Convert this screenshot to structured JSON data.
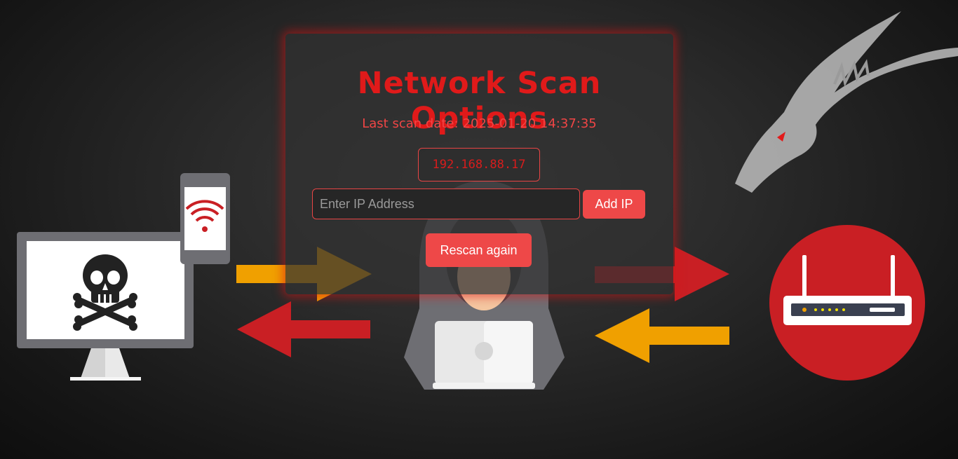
{
  "panel": {
    "title": "Network Scan Options",
    "last_scan_label": "Last scan date:",
    "last_scan_value": "2025-01-20 14:37:35",
    "current_ip": "192.168.88.17",
    "ip_input": {
      "value": "",
      "placeholder": "Enter IP Address"
    },
    "add_ip_label": "Add IP",
    "rescan_label": "Rescan again"
  },
  "colors": {
    "accent": "#ee4848",
    "title_red": "#e01a1a",
    "arrow_red": "#c91f24",
    "arrow_orange": "#f0a000",
    "background": "#1e1e1e"
  },
  "icons": {
    "computer": "skull-monitor-icon",
    "phone": "wifi-phone-icon",
    "hacker": "hooded-hacker-icon",
    "router": "router-icon",
    "dragon": "dragon-logo"
  }
}
